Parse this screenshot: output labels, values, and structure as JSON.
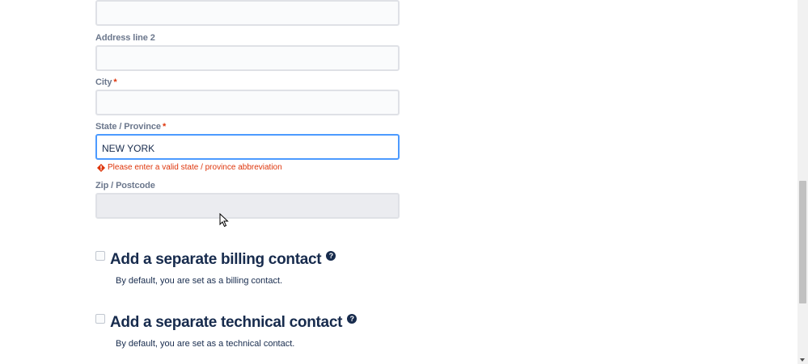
{
  "form": {
    "address_line_1": {
      "value": ""
    },
    "address_line_2": {
      "label": "Address line 2",
      "value": ""
    },
    "city": {
      "label": "City",
      "required_mark": "*",
      "value": ""
    },
    "state": {
      "label": "State / Province",
      "required_mark": "*",
      "value": "NEW YORK",
      "error": "Please enter a valid state / province abbreviation"
    },
    "zip": {
      "label": "Zip / Postcode",
      "value": ""
    }
  },
  "billing_contact": {
    "title": "Add a separate billing contact",
    "description": "By default, you are set as a billing contact.",
    "checked": false
  },
  "technical_contact": {
    "title": "Add a separate technical contact",
    "description": "By default, you are set as a technical contact.",
    "checked": false
  },
  "colors": {
    "label": "#6b778c",
    "text": "#172b4d",
    "error": "#de350b",
    "focus_border": "#4c9aff",
    "input_border": "#dfe1e6",
    "input_bg": "#fafbfc"
  },
  "icons": {
    "error": "error-icon",
    "help": "help-icon",
    "cursor": "mouse-cursor-icon"
  }
}
